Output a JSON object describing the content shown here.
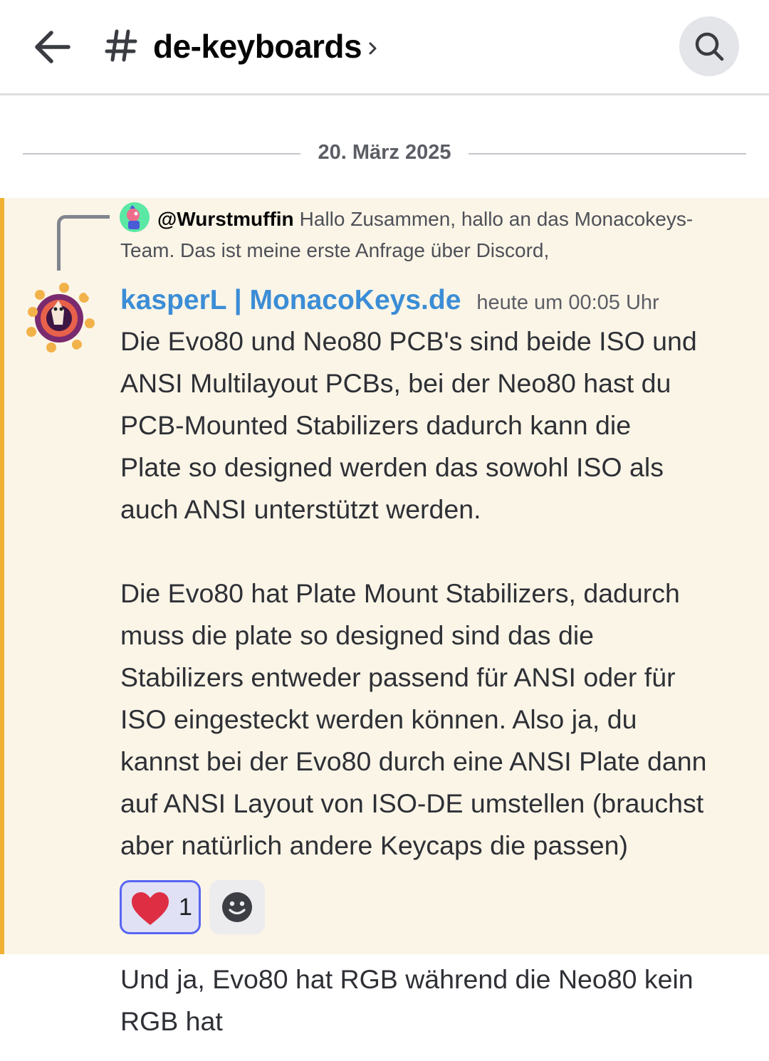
{
  "header": {
    "channel_name": "de-keyboards"
  },
  "date_divider": "20. März 2025",
  "message": {
    "reply": {
      "author": "@Wurstmuffin",
      "preview": "Hallo Zusammen, hallo an das Monacokeys-Team. Das ist meine erste Anfrage über Discord,"
    },
    "author": "kasperL | MonacoKeys.de",
    "author_color": "#3b8dd6",
    "timestamp": "heute um 00:05 Uhr",
    "paragraph_1": "Die Evo80 und Neo80 PCB's sind beide ISO und\nANSI Multilayout PCBs, bei der Neo80 hast du\nPCB-Mounted Stabilizers dadurch kann die\nPlate so designed werden das sowohl ISO als\nauch ANSI unterstützt werden.",
    "paragraph_2": "Die Evo80 hat Plate Mount Stabilizers, dadurch\nmuss die plate so designed sind das die\nStabilizers entweder passend für ANSI oder für\nISO eingesteckt werden können. Also ja, du\nkannst bei der Evo80 durch eine ANSI Plate dann\nauf ANSI Layout von ISO-DE umstellen (brauchst\naber natürlich andere Keycaps die passen)",
    "reactions": [
      {
        "emoji": "heart-icon",
        "count": "1",
        "active": true
      }
    ],
    "highlight_color": "#fbf5e7",
    "mention_bar_color": "#f0b132"
  },
  "followup": {
    "text": "Und ja, Evo80 hat RGB während die Neo80 kein\nRGB hat"
  }
}
